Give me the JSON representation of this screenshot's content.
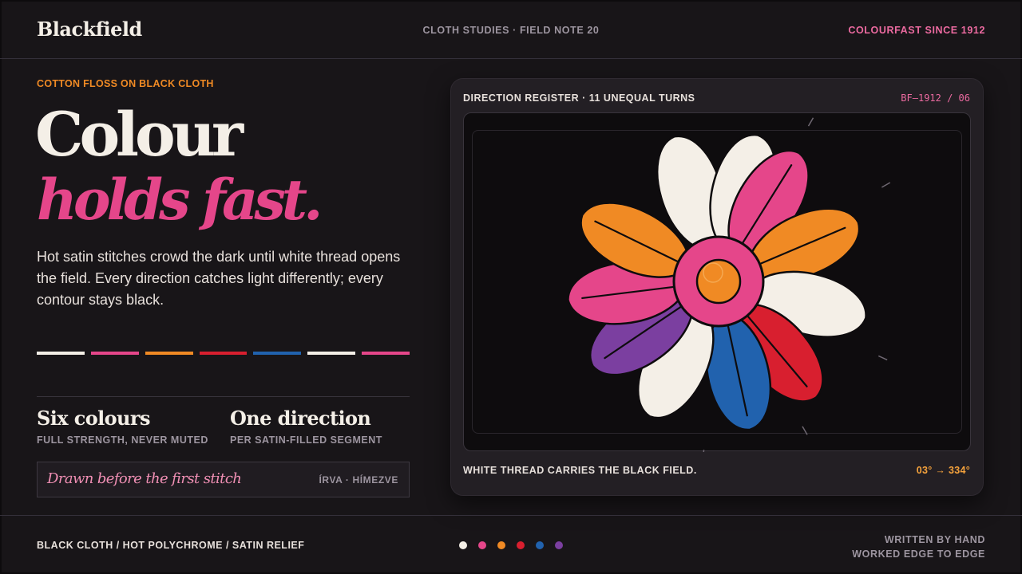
{
  "header": {
    "brand": "Blackfield",
    "center": "CLOTH STUDIES · FIELD NOTE 20",
    "right": "COLOURFAST SINCE 1912"
  },
  "hero": {
    "eyebrow": "COTTON FLOSS ON BLACK CLOTH",
    "line1": "Colour",
    "line2": "holds fast.",
    "lede": "Hot satin stitches crowd the dark until white thread opens the field. Every direction catches light differently; every contour stays black."
  },
  "swatches": [
    "#f4efe7",
    "#e5468a",
    "#f08a24",
    "#d81f2f",
    "#2162ae",
    "#f4efe7",
    "#e5468a"
  ],
  "stats": [
    {
      "title": "Six colours",
      "sub": "FULL STRENGTH, NEVER MUTED"
    },
    {
      "title": "One direction",
      "sub": "PER SATIN-FILLED SEGMENT"
    }
  ],
  "note": {
    "script": "Drawn before the first stitch",
    "tag": "ÍRVA · HÍMEZVE"
  },
  "card": {
    "title": "DIRECTION REGISTER · 11 UNEQUAL TURNS",
    "code": "BF—1912 / 06",
    "footer": "WHITE THREAD CARRIES THE BLACK FIELD.",
    "range": "03° → 334°"
  },
  "flower": {
    "petals": [
      {
        "angle": 343,
        "color": "#f4efe7",
        "vein": false
      },
      {
        "angle": 15,
        "color": "#f4efe7",
        "vein": false
      },
      {
        "angle": 32,
        "color": "#e5468a",
        "vein": true
      },
      {
        "angle": 67,
        "color": "#f08a24",
        "vein": true
      },
      {
        "angle": 104,
        "color": "#f4efe7",
        "vein": false
      },
      {
        "angle": 140,
        "color": "#d81f2f",
        "vein": true
      },
      {
        "angle": 168,
        "color": "#2162ae",
        "vein": true
      },
      {
        "angle": 207,
        "color": "#f4efe7",
        "vein": false
      },
      {
        "angle": 236,
        "color": "#7b3fa0",
        "vein": true
      },
      {
        "angle": 263,
        "color": "#e5468a",
        "vein": true
      },
      {
        "angle": 296,
        "color": "#f08a24",
        "vein": true
      }
    ],
    "outline": "#0e0c0e",
    "center_ring": "#e5468a",
    "center_core": "#f08a24"
  },
  "footer": {
    "left": "BLACK CLOTH / HOT POLYCHROME / SATIN RELIEF",
    "right1": "WRITTEN BY HAND",
    "right2": "WORKED EDGE TO EDGE",
    "dots": [
      "#f4efe7",
      "#e5468a",
      "#f08a24",
      "#d81f2f",
      "#2162ae",
      "#7b3fa0"
    ]
  }
}
